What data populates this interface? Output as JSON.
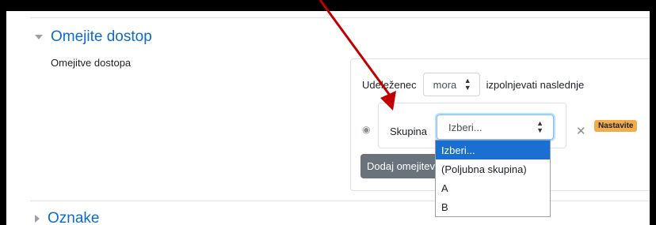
{
  "section": {
    "title": "Omejite dostop"
  },
  "field": {
    "label": "Omejitve dostopa"
  },
  "restriction": {
    "prefix": "Udeleženec",
    "must_value": "mora",
    "suffix": "izpolnjevati naslednje"
  },
  "condition": {
    "type_label": "Skupina",
    "selected": "Izberi...",
    "badge": "Nastavite"
  },
  "add_button": {
    "label": "Dodaj omejitev..."
  },
  "dropdown": {
    "options": [
      "Izberi...",
      "(Poljubna skupina)",
      "A",
      "B"
    ],
    "selected_index": 0
  },
  "next_section": {
    "title": "Oznake"
  },
  "colors": {
    "link": "#0f6cbf",
    "highlight": "#1a6fd1",
    "badge": "#f0ad4e",
    "arrow": "#c00000"
  },
  "icons": [
    "eye-icon",
    "close-icon",
    "caret-down-icon",
    "caret-right-icon",
    "select-updown-icon"
  ]
}
